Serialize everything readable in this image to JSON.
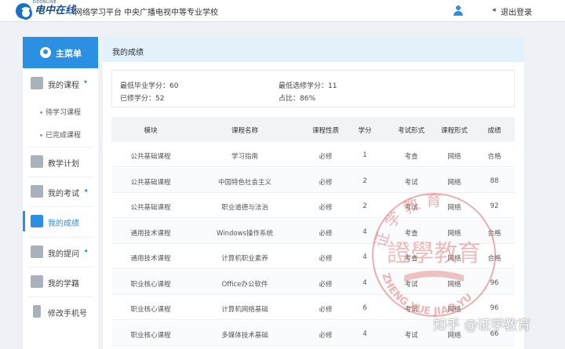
{
  "topbar": {
    "logo_text": "电中在线",
    "logo_sub": "DZONLINE",
    "label1": "网络学习平台",
    "label2": "中央广播电视中等专业学校",
    "logout": "退出登录",
    "logout_arrow": "◂"
  },
  "sidebar": {
    "header": "主菜单",
    "items": [
      {
        "label": "我的课程",
        "icon": "video-icon",
        "arrow": "▾"
      },
      {
        "label": "教学计划",
        "icon": "calendar-icon"
      },
      {
        "label": "我的考试",
        "icon": "edit-icon",
        "arrow": "◂"
      },
      {
        "label": "我的成绩",
        "icon": "score-icon",
        "active": true
      },
      {
        "label": "我的提问",
        "icon": "question-icon",
        "arrow": "◂"
      },
      {
        "label": "我的学籍",
        "icon": "id-card-icon"
      },
      {
        "label": "修改手机号",
        "icon": "phone-icon"
      }
    ],
    "subitems": [
      "待学习课程",
      "已完成课程"
    ],
    "accent": "#2b8fe2"
  },
  "main": {
    "title": "我的成绩",
    "summary": {
      "min_grad": "最低毕业学分：60",
      "min_elective": "最低选修学分：11",
      "earned": "已修学分：52",
      "ratio": "占比：86%"
    },
    "columns": [
      "模块",
      "课程名称",
      "课程性质",
      "学分",
      "考试形式",
      "课程形式",
      "成绩"
    ],
    "rows": [
      [
        "公共基础课程",
        "学习指南",
        "必修",
        "1",
        "考查",
        "网络",
        "合格"
      ],
      [
        "公共基础课程",
        "中国特色社会主义",
        "必修",
        "2",
        "考试",
        "网络",
        "88"
      ],
      [
        "公共基础课程",
        "职业道德与法治",
        "必修",
        "2",
        "考试",
        "网络",
        "92"
      ],
      [
        "通用技术课程",
        "Windows操作系统",
        "必修",
        "4",
        "考查",
        "网络",
        "合格"
      ],
      [
        "通用技术课程",
        "计算机职业素养",
        "必修",
        "4",
        "考查",
        "网络",
        "合格"
      ],
      [
        "职业核心课程",
        "Office办公软件",
        "必修",
        "4",
        "考试",
        "网络",
        "96"
      ],
      [
        "职业核心课程",
        "计算机网络基础",
        "必修",
        "6",
        "考试",
        "网络",
        "96"
      ],
      [
        "职业核心课程",
        "多媒体技术基础",
        "必修",
        "4",
        "考试",
        "网络",
        "66"
      ]
    ]
  },
  "watermark": {
    "seal_top": "证 学 教 育",
    "seal_center": "證學教育",
    "seal_bottom": "ZHENG XUE JIAO YU",
    "corner": "知乎 @证学教育",
    "color": "#e07a7a"
  }
}
